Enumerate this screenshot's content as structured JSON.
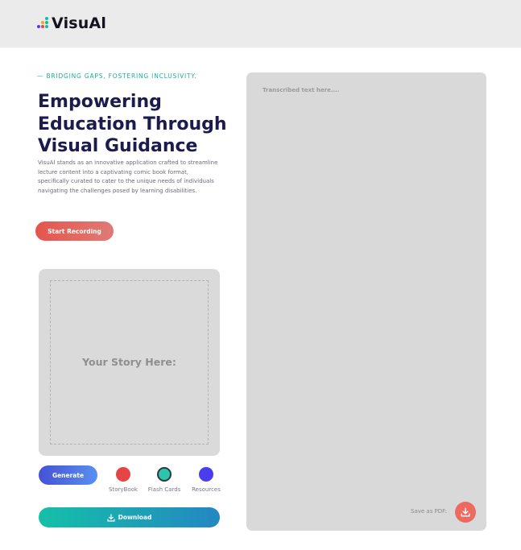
{
  "header": {
    "brand": "VisuAl"
  },
  "hero": {
    "tagline": "— BRIDGING GAPS, FOSTERING INCLUSIVITY.",
    "headline_lines": [
      "Empowering",
      "Education Through",
      "Visual Guidance"
    ],
    "description": "VisuAl stands as an innovative application crafted to streamline lecture content into a captivating comic book format, specifically curated to cater to the unique needs of individuals navigating the challenges posed by learning disabilities.",
    "record_label": "Start Recording"
  },
  "story": {
    "placeholder": "Your Story Here:"
  },
  "actions": {
    "generate_label": "Generate",
    "options": [
      {
        "label": "StoryBook",
        "color": "#e64545",
        "selected": false
      },
      {
        "label": "Flash Cards",
        "color": "#2cc4ae",
        "selected": true
      },
      {
        "label": "Resources",
        "color": "#4a3df0",
        "selected": false
      }
    ],
    "download_label": "Download"
  },
  "transcript": {
    "placeholder": "Transcribed text here....",
    "save_label": "Save as PDF:"
  },
  "colors": {
    "accent_teal": "#1aaf9b",
    "headline": "#1c1b4d",
    "record": "#e4564c",
    "generate": "#4452d6",
    "download_start": "#14c0a8",
    "download_end": "#2487c2"
  }
}
